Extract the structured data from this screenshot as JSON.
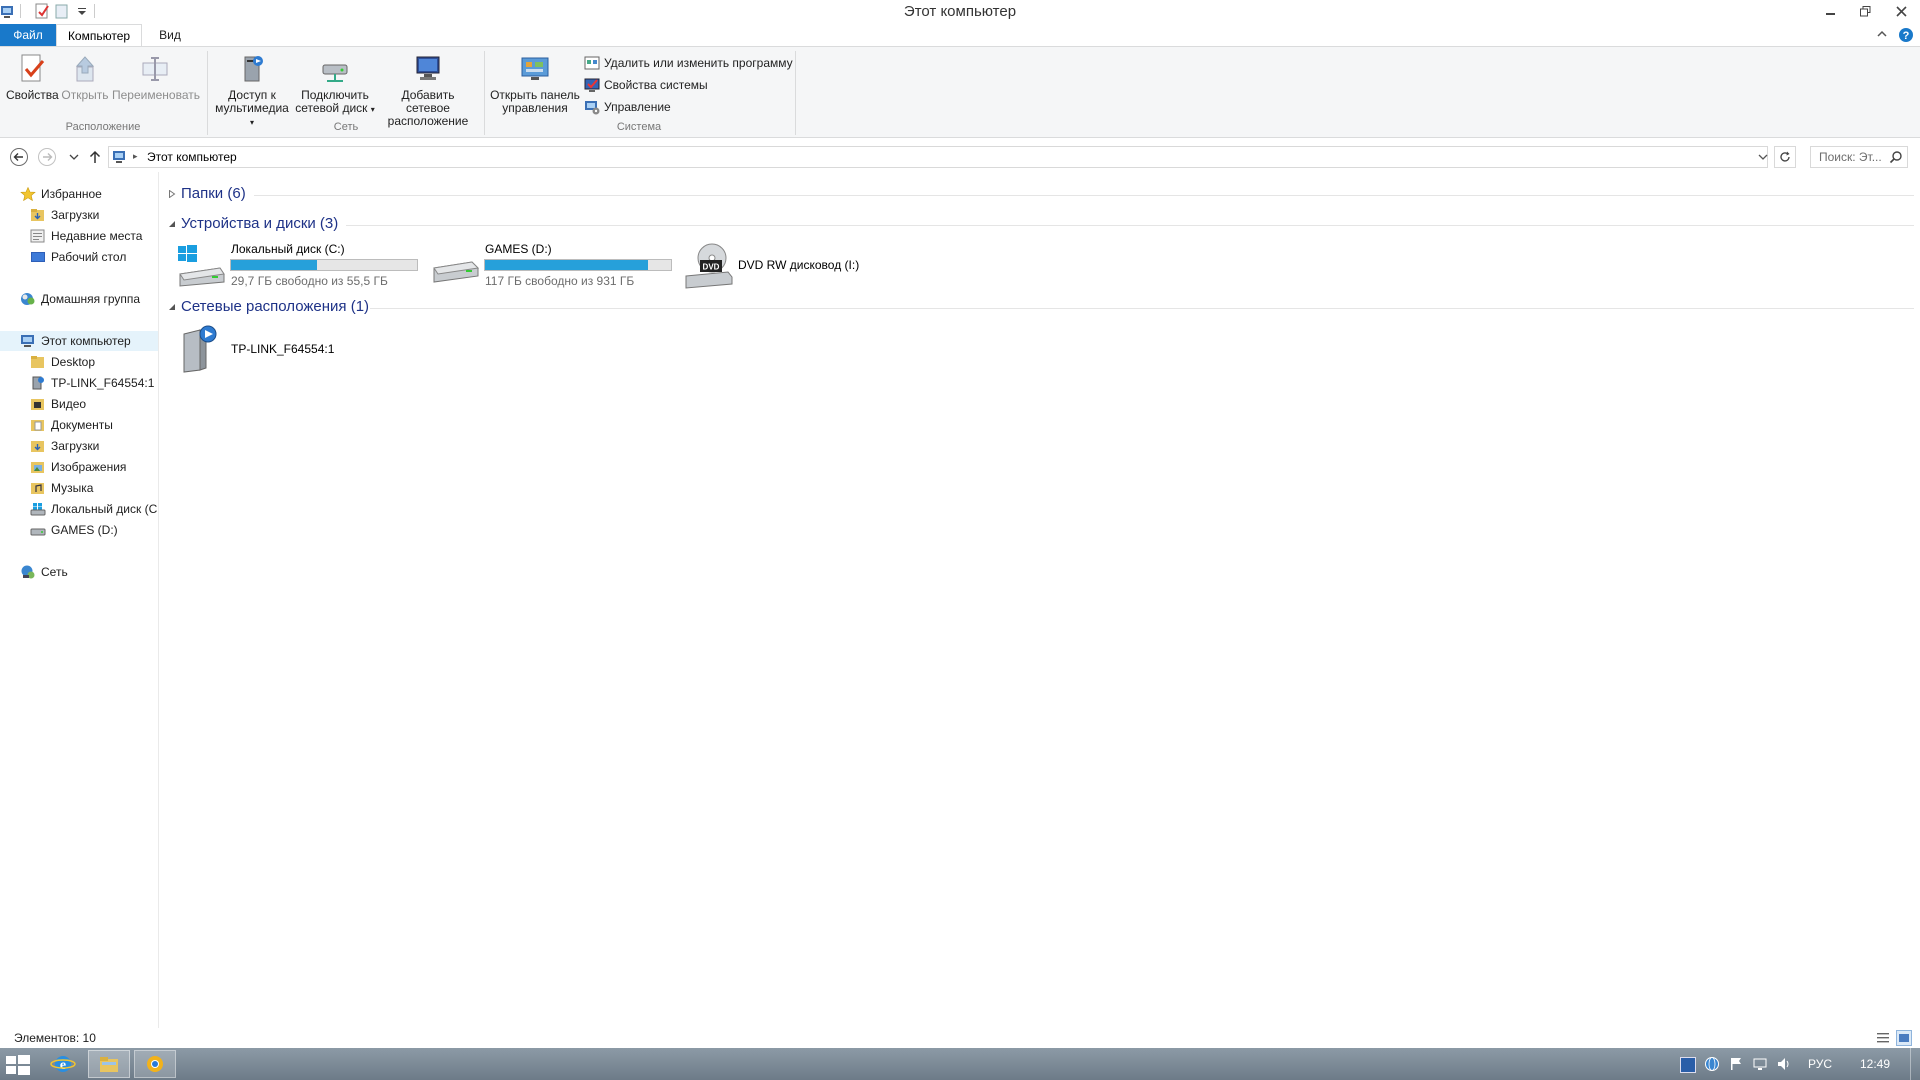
{
  "window": {
    "title": "Этот компьютер"
  },
  "ribbon": {
    "tabs": {
      "file": "Файл",
      "computer": "Компьютер",
      "view": "Вид"
    },
    "location_group": {
      "label": "Расположение",
      "properties": "Свойства",
      "open": "Открыть",
      "rename": "Переименовать"
    },
    "network_group": {
      "label": "Сеть",
      "media_line1": "Доступ к",
      "media_line2": "мультимедиа",
      "map_line1": "Подключить",
      "map_line2": "сетевой диск",
      "add_line1": "Добавить сетевое",
      "add_line2": "расположение"
    },
    "system_group": {
      "label": "Система",
      "cpanel_line1": "Открыть панель",
      "cpanel_line2": "управления",
      "uninstall": "Удалить или изменить программу",
      "sysprops": "Свойства системы",
      "manage": "Управление"
    }
  },
  "address": {
    "path": "Этот компьютер",
    "search_placeholder": "Поиск: Эт..."
  },
  "nav": {
    "favorites": "Избранное",
    "fav_items": [
      "Загрузки",
      "Недавние места",
      "Рабочий стол"
    ],
    "homegroup": "Домашняя группа",
    "this_pc": "Этот компьютер",
    "pc_items": [
      "Desktop",
      "TP-LINK_F64554:1",
      "Видео",
      "Документы",
      "Загрузки",
      "Изображения",
      "Музыка",
      "Локальный диск (C",
      "GAMES (D:)"
    ],
    "network": "Сеть"
  },
  "content": {
    "folders_header": "Папки (6)",
    "devices_header": "Устройства и диски (3)",
    "network_header": "Сетевые расположения (1)",
    "drives": [
      {
        "name": "Локальный диск (C:)",
        "free": "29,7 ГБ свободно из 55,5 ГБ",
        "used_fraction": 0.465
      },
      {
        "name": "GAMES (D:)",
        "free": "117 ГБ свободно из 931 ГБ",
        "used_fraction": 0.874
      },
      {
        "name": "DVD RW дисковод (I:)"
      }
    ],
    "network_locations": [
      {
        "name": "TP-LINK_F64554:1"
      }
    ]
  },
  "status": {
    "items": "Элементов: 10"
  },
  "taskbar": {
    "language": "РУС",
    "time": "12:49"
  },
  "colors": {
    "accent": "#1979ca",
    "bar_fill": "#26a0da",
    "header_text": "#1e3287"
  }
}
